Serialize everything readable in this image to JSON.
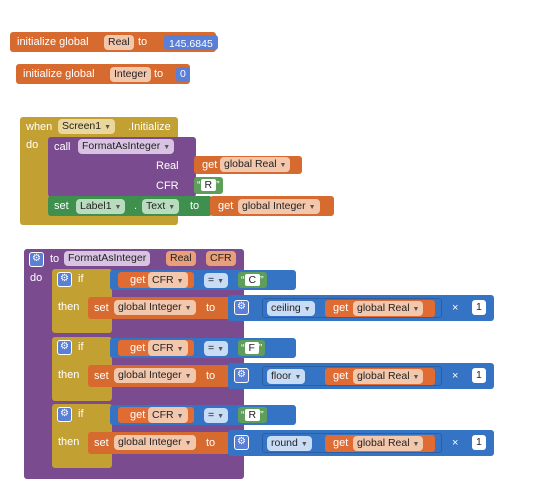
{
  "init_real": {
    "prefix": "initialize global",
    "name": "Real",
    "to": "to",
    "value": "145.6845"
  },
  "init_int": {
    "prefix": "initialize global",
    "name": "Integer",
    "to": "to",
    "value": "0"
  },
  "when": {
    "when": "when",
    "component": "Screen1",
    "event": ".Initialize",
    "do": "do",
    "call": "call",
    "proc": "FormatAsInteger",
    "arg_real": "Real",
    "get_real": "get",
    "get_real_var": "global Real",
    "arg_cfr": "CFR",
    "cfr_value": "R",
    "set": "set",
    "set_comp": "Label1",
    "set_prop": "Text",
    "set_to": "to",
    "get_int": "get",
    "get_int_var": "global Integer"
  },
  "proc": {
    "to": "to",
    "name": "FormatAsInteger",
    "param1": "Real",
    "param2": "CFR",
    "do": "do",
    "if": "if",
    "then": "then",
    "get": "get",
    "cfr": "CFR",
    "eq": "=",
    "set": "set",
    "global_int": "global Integer",
    "global_real": "global Real",
    "times": "×",
    "one": "1",
    "branches": [
      {
        "letter": "C",
        "func": "ceiling"
      },
      {
        "letter": "F",
        "func": "floor"
      },
      {
        "letter": "R",
        "func": "round"
      }
    ]
  },
  "colors": {
    "variable": "#d76a2e",
    "event": "#c2a032",
    "procedure": "#7a4b8f",
    "component": "#3f8f4f",
    "math": "#3573c4"
  }
}
